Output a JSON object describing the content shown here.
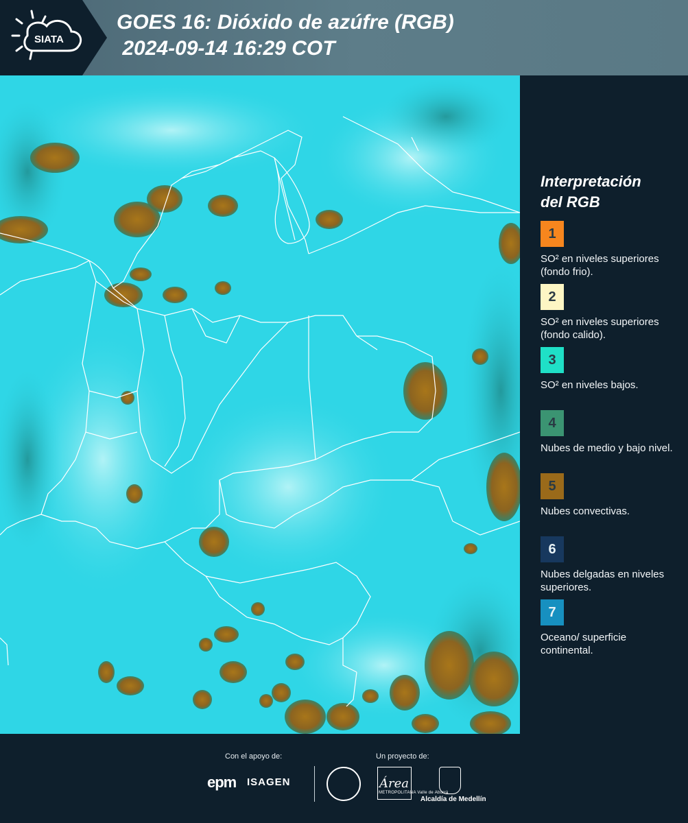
{
  "header": {
    "logo_text": "SIATA",
    "title": "GOES 16: Dióxido de azúfre (RGB)\n 2024-09-14 16:29 COT"
  },
  "legend": {
    "title_line1": "Interpretación",
    "title_line2": "del RGB",
    "items": [
      {
        "number": "1",
        "color": "#f7861e",
        "text": "SO² en niveles superiores (fondo frio)."
      },
      {
        "number": "2",
        "color": "#fdf6c4",
        "text": "SO² en niveles superiores (fondo calido)."
      },
      {
        "number": "3",
        "color": "#1fe0c7",
        "text": "SO² en niveles bajos."
      },
      {
        "number": "4",
        "color": "#3b9472",
        "text": "Nubes de medio y bajo nivel."
      },
      {
        "number": "5",
        "color": "#9a6a1a",
        "text": "Nubes convectivas."
      },
      {
        "number": "6",
        "color": "#17385e",
        "text": "Nubes delgadas en niveles superiores."
      },
      {
        "number": "7",
        "color": "#1790c0",
        "text": "Oceano/ superficie continental."
      }
    ]
  },
  "footer": {
    "support_label": "Con el apoyo de:",
    "project_label": "Un proyecto de:",
    "sponsor1": "epm",
    "sponsor2": "ISAGEN",
    "partner_area": "Área",
    "partner_area_sub": "METROPOLITANA Valle de Aburrá",
    "partner_alcaldia": "Alcaldía de Medellín"
  },
  "map": {
    "background_color": "#2fd6e6",
    "cloud_color": "#9a6a1a",
    "border_color": "#ffffff"
  }
}
